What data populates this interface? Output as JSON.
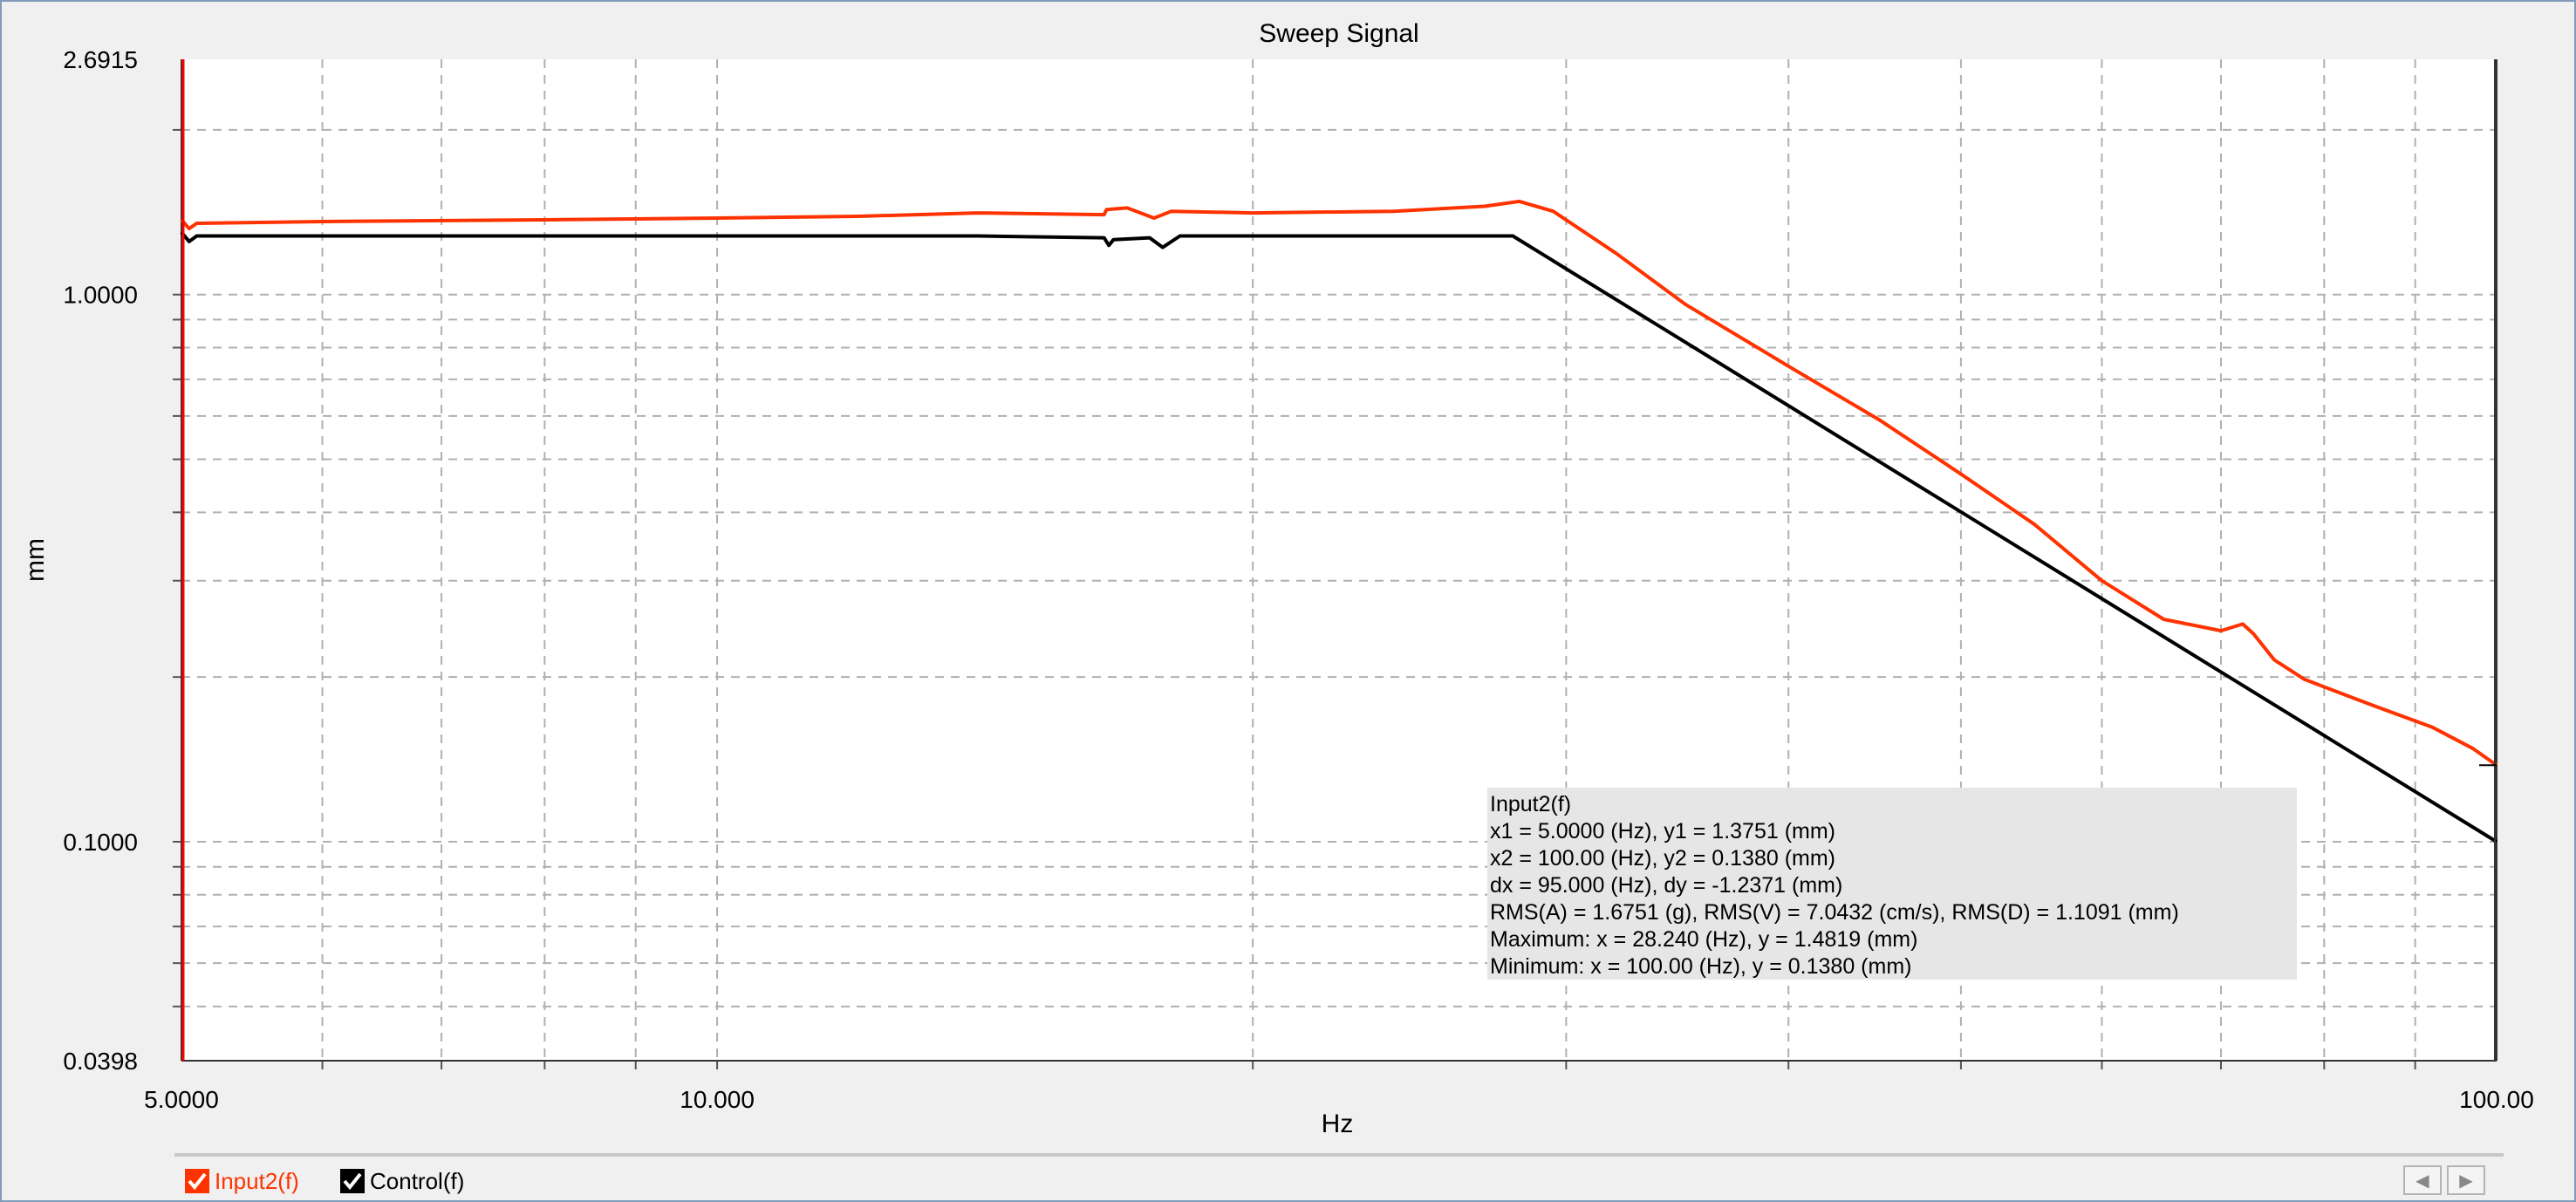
{
  "chart_data": {
    "type": "line",
    "title": "Sweep Signal",
    "xlabel": "Hz",
    "ylabel": "mm",
    "xscale": "log",
    "yscale": "log",
    "xlim": [
      5.0,
      100.0
    ],
    "ylim": [
      0.0398,
      2.6915
    ],
    "x_tick_labels": [
      "5.0000",
      "10.000",
      "100.00"
    ],
    "x_tick_values": [
      5.0,
      10.0,
      100.0
    ],
    "y_tick_labels": [
      "2.6915",
      "1.0000",
      "0.1000",
      "0.0398"
    ],
    "y_tick_values": [
      2.6915,
      1.0,
      0.1,
      0.0398
    ],
    "grid": true,
    "series": [
      {
        "name": "Input2(f)",
        "color": "#ff3300",
        "x": [
          5.0,
          5.05,
          5.1,
          6.0,
          8.0,
          10.0,
          12.0,
          14.0,
          16.5,
          16.55,
          17.0,
          17.6,
          18.0,
          20.0,
          24.0,
          27.0,
          28.24,
          29.5,
          32.0,
          35.0,
          40.0,
          45.0,
          50.0,
          55.0,
          60.0,
          65.0,
          70.0,
          72.0,
          73.0,
          75.0,
          78.0,
          85.0,
          92.0,
          97.0,
          100.0
        ],
        "y": [
          1.37,
          1.32,
          1.35,
          1.36,
          1.37,
          1.38,
          1.39,
          1.41,
          1.4,
          1.43,
          1.44,
          1.38,
          1.42,
          1.41,
          1.42,
          1.45,
          1.48,
          1.42,
          1.19,
          0.96,
          0.74,
          0.59,
          0.47,
          0.38,
          0.3,
          0.255,
          0.243,
          0.25,
          0.24,
          0.215,
          0.198,
          0.178,
          0.162,
          0.148,
          0.138
        ]
      },
      {
        "name": "Control(f)",
        "color": "#000000",
        "x": [
          5.0,
          5.05,
          5.1,
          6.0,
          8.0,
          10.0,
          14.0,
          16.5,
          16.6,
          16.7,
          17.5,
          17.8,
          18.2,
          22.0,
          28.0,
          100.0
        ],
        "y": [
          1.3,
          1.25,
          1.28,
          1.28,
          1.28,
          1.28,
          1.28,
          1.27,
          1.23,
          1.26,
          1.27,
          1.22,
          1.28,
          1.28,
          1.28,
          0.1
        ]
      }
    ],
    "annotation_lines": [
      "Input2(f)",
      "x1 = 5.0000 (Hz), y1 = 1.3751 (mm)",
      "x2 = 100.00 (Hz), y2 = 0.1380 (mm)",
      "dx = 95.000 (Hz), dy = -1.2371 (mm)",
      "RMS(A) = 1.6751 (g), RMS(V) = 7.0432 (cm/s), RMS(D) = 1.1091 (mm)",
      "Maximum: x = 28.240 (Hz), y = 1.4819 (mm)",
      "Minimum: x = 100.00 (Hz), y = 0.1380 (mm)"
    ]
  },
  "legend": {
    "items": [
      {
        "label": "Input2(f)",
        "color": "#ff3300",
        "checked": true
      },
      {
        "label": "Control(f)",
        "color": "#000000",
        "checked": true
      }
    ],
    "scroll_left_icon": "chevron-left-icon",
    "scroll_right_icon": "chevron-right-icon"
  },
  "colors": {
    "background": "#f0f0f0",
    "plot_background": "#ffffff",
    "cursor": "#ff0000",
    "grid": "#b0b0b0",
    "annotation_bg": "#e6e6e6"
  }
}
